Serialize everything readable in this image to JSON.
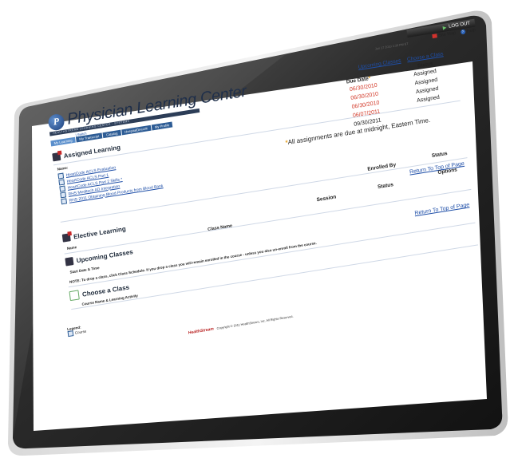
{
  "header": {
    "logout_label": "LOG OUT",
    "datetime": "Jun 17 2010 3:35 PM ET",
    "site_map_label": "Site Map",
    "help_label": "Help",
    "upcoming_classes_link": "Upcoming Classes",
    "choose_class_link": "Choose a Class"
  },
  "brand": {
    "logo_letter": "P",
    "title": "Physician Learning Center",
    "subtitle": "HEALTHSTREAM LEARNING CENTER - SYSTEMS"
  },
  "util_links": {
    "separator": "|",
    "text": "Switch"
  },
  "tabs": [
    {
      "label": "My Learning"
    },
    {
      "label": "My Transcript"
    },
    {
      "label": "Catalog"
    },
    {
      "label": "HospitalDirect®"
    },
    {
      "label": "My Profile"
    }
  ],
  "assigned": {
    "title": "Assigned Learning",
    "col_name": "Name:",
    "col_due": "Due Date",
    "col_status": "Status",
    "items": [
      {
        "name": "HeartCode ACLS Evaluation",
        "due": "06/30/2010",
        "status": "Assigned"
      },
      {
        "name": "HeartCode ACLS Part 1",
        "due": "06/30/2010",
        "status": "Assigned"
      },
      {
        "name": "HeartCode ACLS Part 2 Skills *",
        "due": "06/30/2010",
        "status": "Assigned"
      },
      {
        "name": "RHS Meditech AD Integration",
        "due": "06/07/2011",
        "status": "Assigned"
      },
      {
        "name": "RHS 2011 Obtaining Blood Products from Blood Bank",
        "due": "09/30/2011",
        "status": ""
      }
    ],
    "note_star": "*",
    "note": "All assignments are due at midnight, Eastern Time."
  },
  "elective": {
    "title": "Elective Learning",
    "col_name": "Name",
    "col_enrolled": "Enrolled By",
    "col_status": "Status",
    "return_link": "Return To Top of Page"
  },
  "upcoming": {
    "title": "Upcoming Classes",
    "col_start": "Start Date & Time",
    "col_class": "Class Name",
    "col_session": "Session",
    "col_status": "Status",
    "col_options": "Options",
    "note": "NOTE: To drop a class, click Class Schedule. If you drop a class you will remain enrolled in the course - unless you also un-enroll from the course.",
    "return_link": "Return To Top of Page"
  },
  "choose": {
    "title": "Choose a Class",
    "col_course": "Course Name & Learning Activity"
  },
  "legend": {
    "title": "Legend:",
    "course_label": "Course"
  },
  "footer": {
    "brand": "HealthStream",
    "copyright": "Copyright © 2011 HealthStream, Inc. All Rights Reserved."
  },
  "colors": {
    "accent": "#2d5c95",
    "date_red": "#d33a2a",
    "link": "#1f4fa8"
  }
}
